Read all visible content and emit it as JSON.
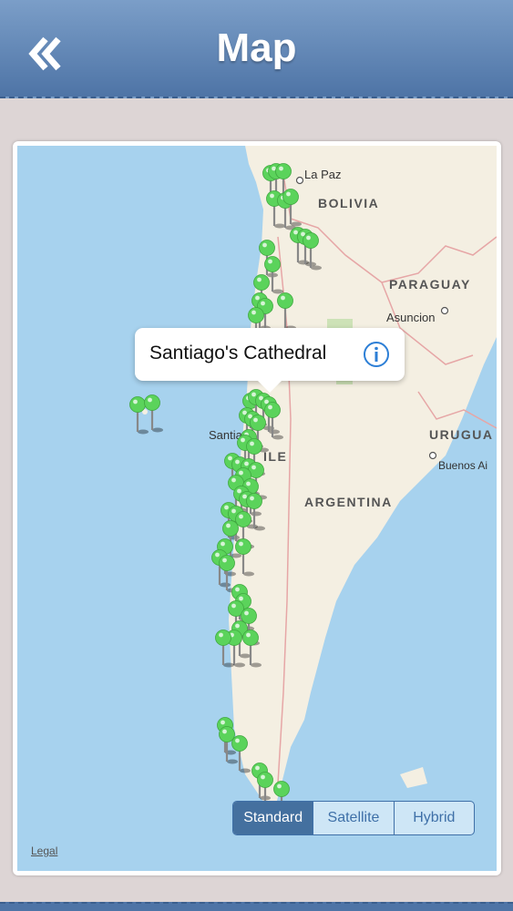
{
  "header": {
    "title": "Map"
  },
  "map": {
    "labels": {
      "la_paz": "La Paz",
      "bolivia": "BOLIVIA",
      "paraguay": "PARAGUAY",
      "asuncion": "Asuncion",
      "santiago": "Santia",
      "chile": "ILE",
      "argentina": "ARGENTINA",
      "uruguay": "URUGUA",
      "buenos_aires": "Buenos Ai"
    },
    "callout": {
      "title": "Santiago's Cathedral"
    },
    "pin_color": "#5bd35b",
    "map_types": [
      "Standard",
      "Satellite",
      "Hybrid"
    ],
    "selected_map_type": "Standard",
    "legal": "Legal"
  }
}
